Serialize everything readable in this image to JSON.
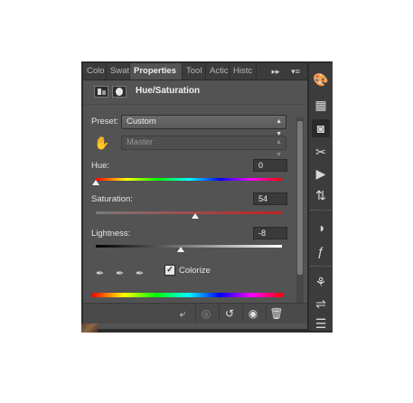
{
  "panel": {
    "tabs": [
      "Colo",
      "Swat",
      "Properties",
      "Tool",
      "Actic",
      "Histc"
    ],
    "active_tab": "Properties",
    "forward_label": "▸▸",
    "menu_label": "▾≡",
    "title": "Hue/Saturation"
  },
  "preset": {
    "label": "Preset:",
    "value": "Custom"
  },
  "channel": {
    "value": "Master"
  },
  "hue": {
    "label": "Hue:",
    "value": "0"
  },
  "saturation": {
    "label": "Saturation:",
    "value": "54"
  },
  "lightness": {
    "label": "Lightness:",
    "value": "-8"
  },
  "colorize": {
    "label": "Colorize",
    "checked": true
  },
  "icons": {
    "strip": [
      "palette-icon",
      "grid-icon",
      "adjustments-icon",
      "scissors-icon",
      "play-icon",
      "layer-comps-icon",
      "brush-preset-icon",
      "fx-icon",
      "clone-source-icon",
      "brush-icon",
      "notes-icon"
    ],
    "footer": [
      "clip-to-layer-icon",
      "view-previous-icon",
      "reset-icon",
      "visibility-icon",
      "delete-icon"
    ]
  },
  "colors": {
    "panel_bg": "#535353",
    "dark_bg": "#3c3c3c",
    "text": "#e6e6e6"
  }
}
